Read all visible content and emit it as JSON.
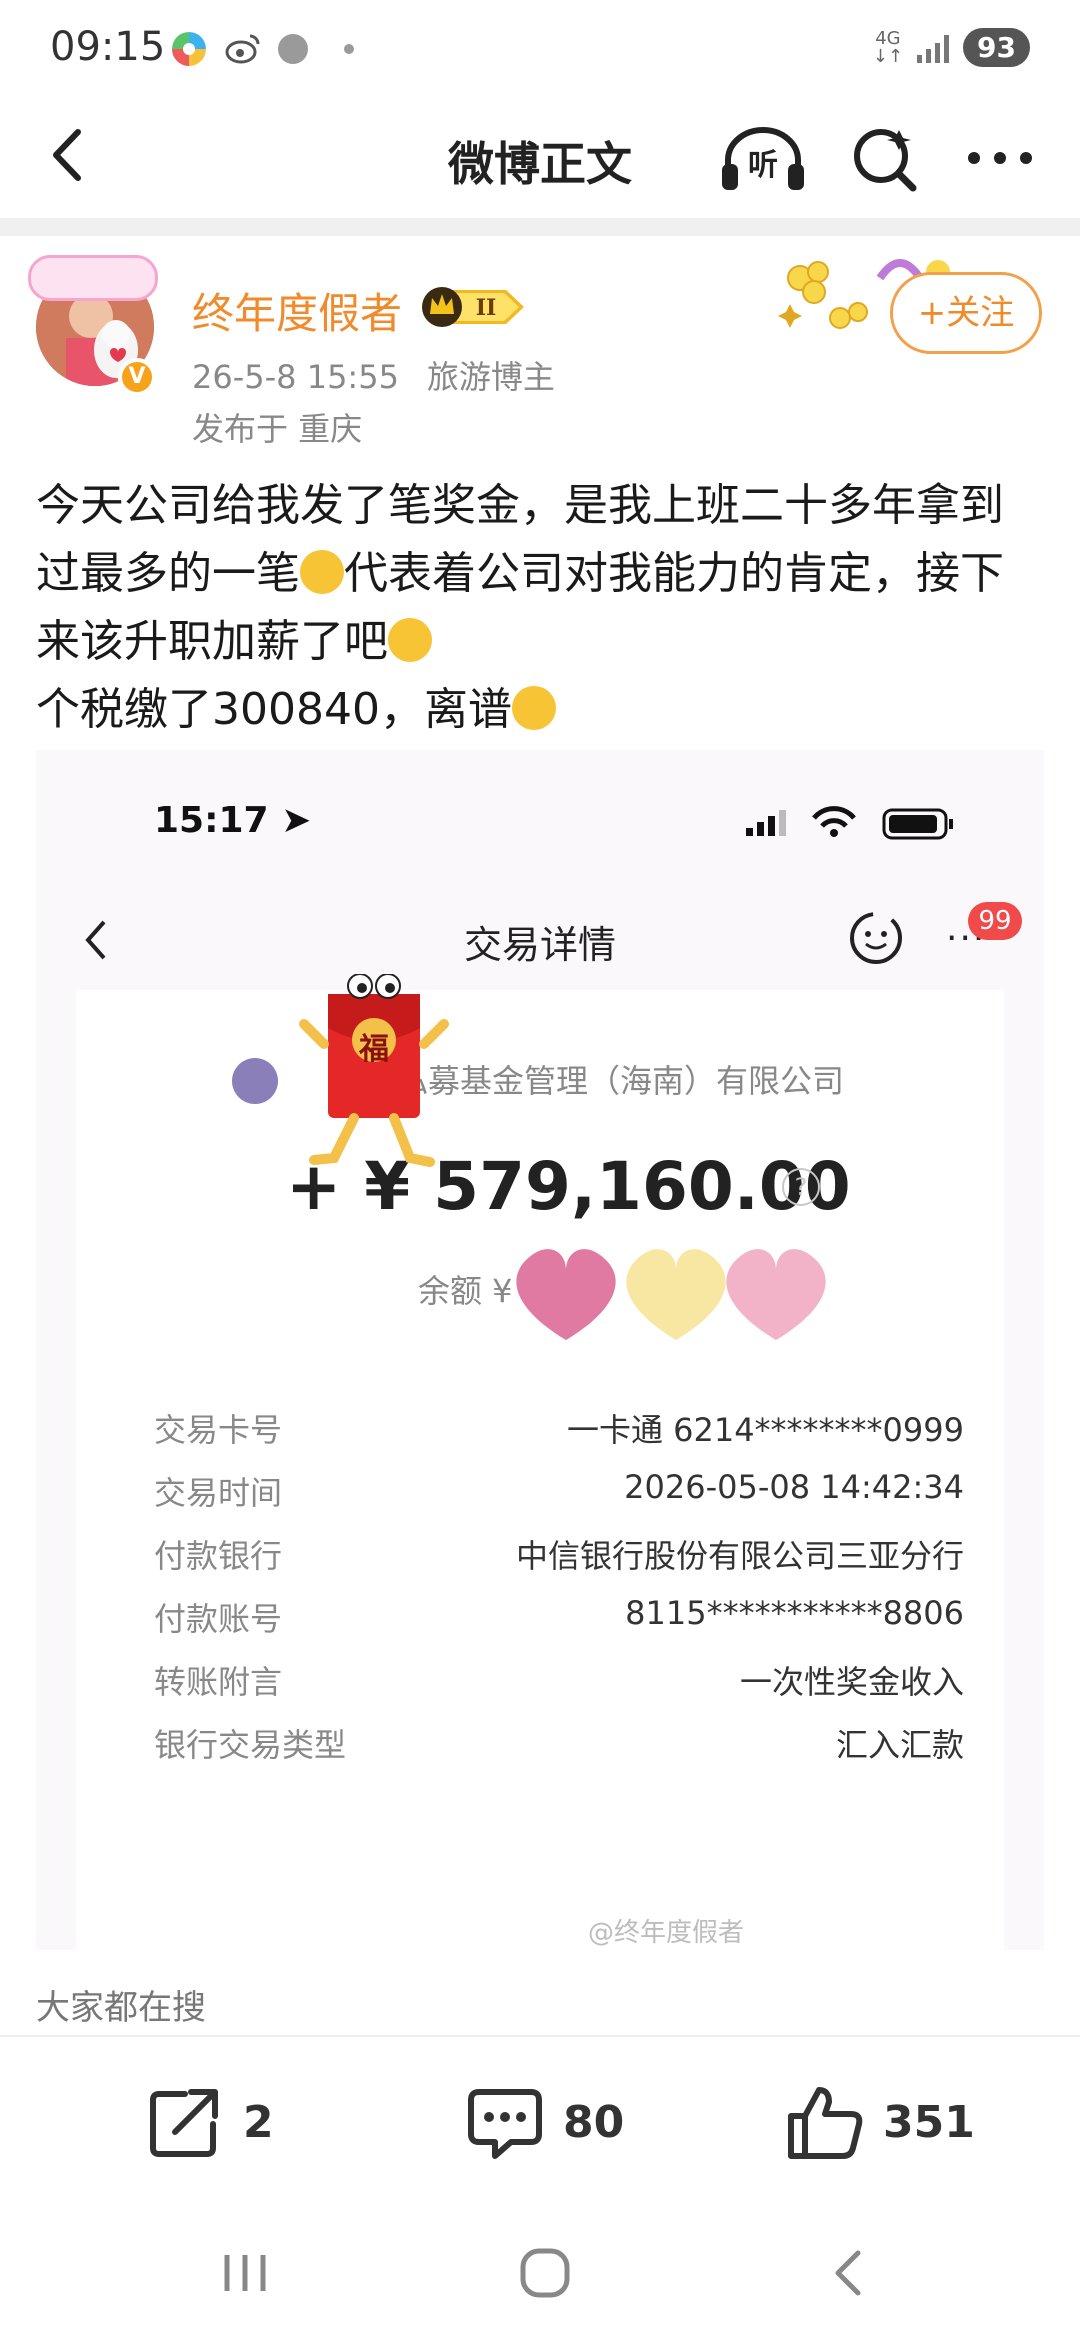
{
  "status_bar": {
    "time": "09:15",
    "network_type": "4G",
    "battery": "93"
  },
  "nav": {
    "title": "微博正文",
    "listen_label": "听"
  },
  "post": {
    "username": "终年度假者",
    "member_level": "II",
    "date": "26-5-8 15:55",
    "tag": "旅游博主",
    "location": "发布于 重庆",
    "follow_label": "+关注",
    "text_line1": "今天公司给我发了笔奖金，是我上班二十多年拿到过最多的一笔",
    "text_line1b": "代表着公司对我能力的肯定，接下来该升职加薪了吧",
    "text_line2": "个税缴了300840，离谱"
  },
  "screenshot": {
    "time": "15:17",
    "title": "交易详情",
    "badge": "99",
    "company": "私募基金管理（海南）有限公司",
    "amount": "+ ¥ 579,160.00",
    "help": "?",
    "balance_label": "余额 ¥",
    "redpacket_char": "福",
    "rows": [
      {
        "label": "交易卡号",
        "value": "一卡通 6214********0999"
      },
      {
        "label": "交易时间",
        "value": "2026-05-08 14:42:34"
      },
      {
        "label": "付款银行",
        "value": "中信银行股份有限公司三亚分行"
      },
      {
        "label": "付款账号",
        "value": "8115***********8806"
      },
      {
        "label": "转账附言",
        "value": "一次性奖金收入"
      },
      {
        "label": "银行交易类型",
        "value": "汇入汇款"
      }
    ],
    "watermark": "@终年度假者"
  },
  "search_hint": "大家都在搜",
  "actions": {
    "share_count": "2",
    "comment_count": "80",
    "like_count": "351"
  }
}
